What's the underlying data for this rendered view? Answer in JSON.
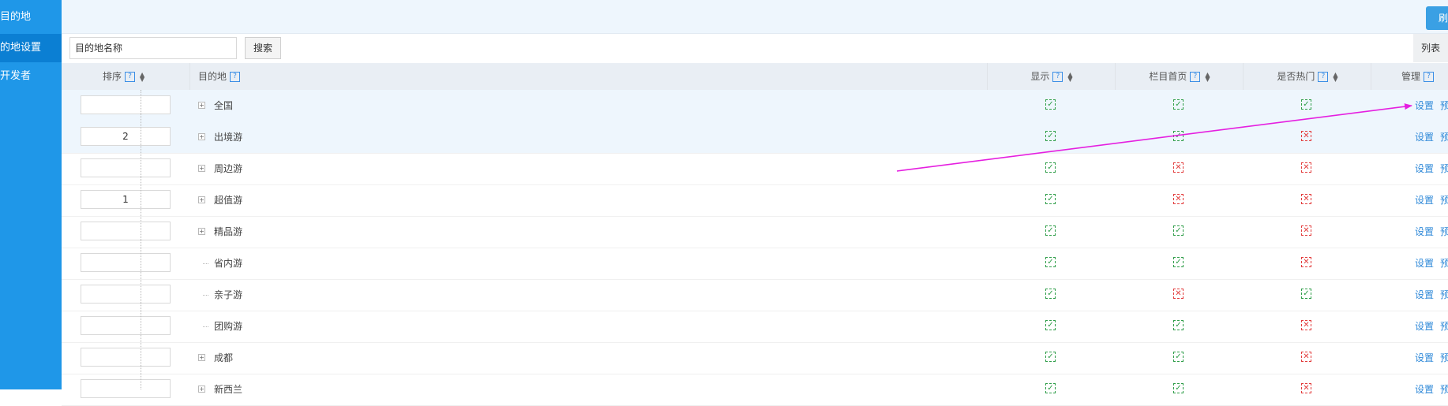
{
  "sidebar": {
    "items": [
      {
        "label": "目的地",
        "active": false
      },
      {
        "label": "的地设置",
        "active": true
      },
      {
        "label": "开发者",
        "active": false
      }
    ]
  },
  "topbar": {
    "button_label": "刷"
  },
  "search": {
    "placeholder": "目的地名称",
    "button_label": "搜索",
    "list_tab": "列表"
  },
  "table": {
    "headers": {
      "order": "排序",
      "destination": "目的地",
      "display": "显示",
      "column_home": "栏目首页",
      "is_hot": "是否热门",
      "manage": "管理"
    },
    "help_glyph": "?",
    "status_icons": {
      "on": "✓",
      "off": "✕",
      "on_color": "#2e9d48",
      "off_color": "#e23b3b"
    },
    "action_labels": {
      "settings": "设置",
      "preview": "预"
    },
    "rows": [
      {
        "order": "",
        "name": "全国",
        "expandable": true,
        "display": true,
        "column_home": true,
        "is_hot": true,
        "highlight": true
      },
      {
        "order": "2",
        "name": "出境游",
        "expandable": true,
        "display": true,
        "column_home": true,
        "is_hot": false,
        "highlight": true
      },
      {
        "order": "",
        "name": "周边游",
        "expandable": true,
        "display": true,
        "column_home": false,
        "is_hot": false,
        "highlight": false
      },
      {
        "order": "1",
        "name": "超值游",
        "expandable": true,
        "display": true,
        "column_home": false,
        "is_hot": false,
        "highlight": false
      },
      {
        "order": "",
        "name": "精品游",
        "expandable": true,
        "display": true,
        "column_home": true,
        "is_hot": false,
        "highlight": false
      },
      {
        "order": "",
        "name": "省内游",
        "expandable": false,
        "display": true,
        "column_home": true,
        "is_hot": false,
        "highlight": false
      },
      {
        "order": "",
        "name": "亲子游",
        "expandable": false,
        "display": true,
        "column_home": false,
        "is_hot": true,
        "highlight": false
      },
      {
        "order": "",
        "name": "团购游",
        "expandable": false,
        "display": true,
        "column_home": true,
        "is_hot": false,
        "highlight": false
      },
      {
        "order": "",
        "name": "成都",
        "expandable": true,
        "display": true,
        "column_home": true,
        "is_hot": false,
        "highlight": false
      },
      {
        "order": "",
        "name": "新西兰",
        "expandable": true,
        "display": true,
        "column_home": true,
        "is_hot": false,
        "highlight": false
      }
    ]
  },
  "annotation": {
    "color": "#e51fe0"
  }
}
